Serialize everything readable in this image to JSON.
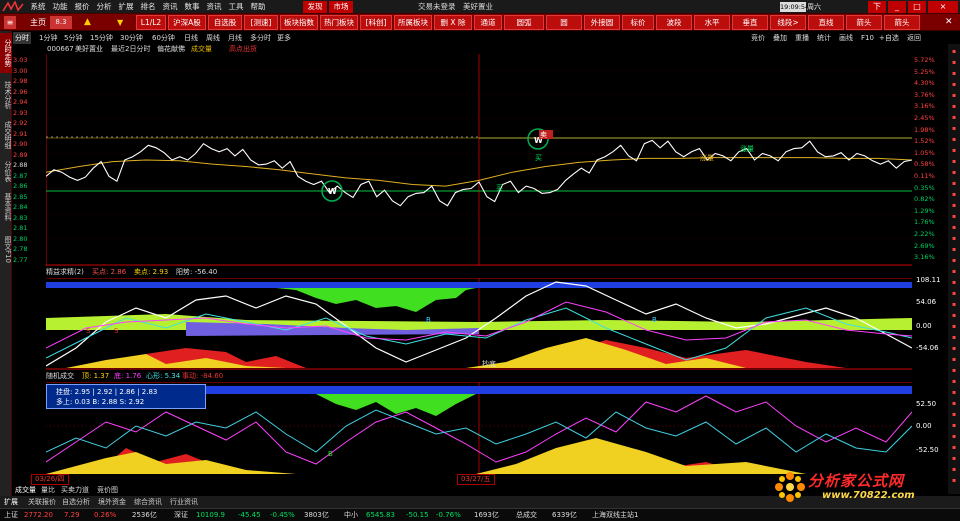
{
  "menubar": {
    "items": [
      "系统",
      "功能",
      "报价",
      "分析",
      "扩展",
      "排名",
      "资讯",
      "数事",
      "资讯",
      "工具",
      "帮助"
    ],
    "discover": "发现",
    "market": "市场",
    "app_title": "交易未登录　美好置业",
    "clock": "19:09:54",
    "weekday": "周六",
    "win_buttons": [
      "下",
      "_",
      "□",
      "×"
    ]
  },
  "toolbar": {
    "home": "主页",
    "code": "8.3",
    "level": "L1/L2",
    "buttons": [
      "沪深A股",
      "自选股",
      "[测速]",
      "板块指数",
      "热门板块",
      "[科创]",
      "所属板块",
      "删 X 除",
      "通道",
      "圆弧",
      "圆",
      "外接圆",
      "标价",
      "波段",
      "水平",
      "垂直",
      "线段>",
      "直线",
      "箭头",
      "箭头"
    ]
  },
  "leftnav": [
    "分时走势",
    "技术分析",
    "成交明细",
    "分价表",
    "基本资料",
    "图文F10"
  ],
  "periods": {
    "left": [
      "分时",
      "1分钟",
      "5分钟",
      "15分钟",
      "30分钟",
      "60分钟",
      "日线",
      "周线",
      "月线",
      "多分时",
      "更多"
    ],
    "right": [
      "竞价",
      "叠加",
      "重播",
      "统计",
      "画线",
      "F10",
      "+自选",
      "返回"
    ]
  },
  "stock": {
    "code": "000667",
    "name": "美好置业",
    "desc": "最近2日分时",
    "tag": "偏花献佛",
    "vol": "成交量",
    "pt": "高点出货",
    "pt_value": ""
  },
  "panel1": {
    "prices": [
      "3.03",
      "3.00",
      "2.98",
      "2.96",
      "2.94",
      "2.93",
      "2.92",
      "2.91",
      "2.90",
      "2.89",
      "2.88",
      "2.87",
      "2.86",
      "2.85",
      "2.84",
      "2.83",
      "2.81",
      "2.80",
      "2.78",
      "2.77"
    ],
    "percents": [
      "5.72%",
      "5.25%",
      "4.30%",
      "3.76%",
      "3.16%",
      "2.45%",
      "1.98%",
      "1.52%",
      "1.05%",
      "0.58%",
      "0.11%",
      "0.35%",
      "0.82%",
      "1.29%",
      "1.76%",
      "2.22%",
      "2.69%",
      "3.16%"
    ],
    "annotations": {
      "buy": "买",
      "sell": "卖",
      "gain": "涨量",
      "w": "W"
    },
    "price_series": [
      2.88,
      2.885,
      2.875,
      2.89,
      2.88,
      2.9,
      2.91,
      2.915,
      2.9,
      2.9,
      2.92,
      2.91,
      2.905,
      2.9,
      2.895,
      2.89,
      2.88,
      2.87,
      2.86,
      2.86,
      2.87,
      2.855,
      2.85,
      2.855,
      2.86,
      2.85,
      2.86,
      2.865,
      2.855,
      2.87,
      2.86,
      2.865,
      2.86,
      2.875,
      2.89,
      2.9,
      2.91,
      2.905,
      2.92,
      2.915,
      2.91,
      2.91,
      2.9,
      2.905,
      2.91,
      2.9,
      2.905,
      2.91,
      2.915,
      2.91,
      2.905,
      2.9,
      2.905,
      2.895,
      2.89,
      2.9
    ],
    "avg_series": [
      2.885,
      2.892,
      2.898,
      2.9,
      2.899,
      2.895,
      2.892,
      2.888,
      2.883,
      2.878,
      2.875,
      2.87,
      2.868,
      2.875,
      2.885,
      2.892,
      2.897,
      2.9,
      2.902,
      2.902,
      2.903,
      2.903,
      2.903,
      2.903,
      2.902,
      2.902,
      2.9
    ]
  },
  "sub1": {
    "title": "精益求精(2)",
    "buy": "买点: 2.86",
    "sell": "卖点: 2.93",
    "yang": "阳势: -56.40",
    "scale": [
      "108.11",
      "54.06",
      "0.00",
      "-54.06"
    ],
    "labels": {
      "s": "S",
      "b": "B",
      "bottom": "抄底"
    }
  },
  "sub2": {
    "title": "随机成交",
    "ding": "顶: 1.37",
    "di": "底: 1.76",
    "heart": "心形: 5.34",
    "sense": "事动: -84.60",
    "scale": [
      "52.50",
      "0.00",
      "-52.50"
    ]
  },
  "tooltip": {
    "l1": "挂盘: 2.95 | 2.92 | 2.86 | 2.83",
    "l2": "多上: 0.03   B: 2.88   S: 2.92"
  },
  "xaxis": {
    "d1": "03/26/四",
    "d2": "03/27/五"
  },
  "bottom_tabs": [
    "成交量",
    "量比",
    "买卖力道",
    "竞价图"
  ],
  "ext_tabs": [
    "扩展",
    "关联报价",
    "自选分析",
    "境外资金",
    "综合资讯",
    "行业资讯"
  ],
  "status": {
    "sh": "上证",
    "sh_val": "2772.20",
    "sh_chg": "7.29",
    "sh_pct": "0.26%",
    "sh_vol": "2536亿",
    "sz": "深证",
    "sz_val": "10109.9",
    "sz_chg": "-45.45",
    "sz_pct": "-0.45%",
    "sz_vol": "3803亿",
    "zx": "中小",
    "zx_val": "6545.83",
    "zx_chg": "-50.15",
    "zx_pct": "-0.76%",
    "zx_vol": "1693亿",
    "total": "总成交",
    "total_vol": "6339亿",
    "server": "上海双线主站1"
  },
  "watermark": {
    "title": "分析家公式网",
    "url": "www.70822.com"
  },
  "colors": {
    "up": "#ff3030",
    "down": "#00e060",
    "toolbar": "#bc0d0d",
    "price_line": "#ffffff",
    "avg_line": "#e0b020"
  }
}
